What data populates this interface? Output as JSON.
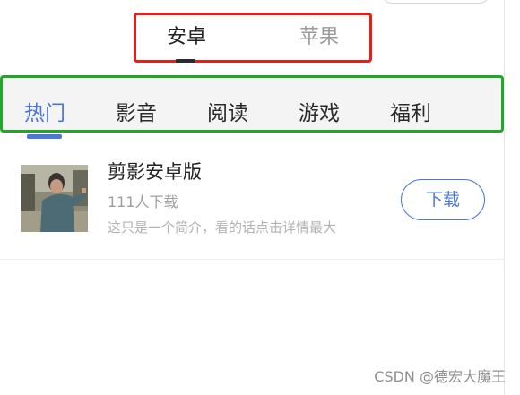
{
  "platform_tabs": [
    {
      "label": "安卓",
      "active": true
    },
    {
      "label": "苹果",
      "active": false
    }
  ],
  "category_tabs": [
    {
      "label": "热门",
      "active": true
    },
    {
      "label": "影音",
      "active": false
    },
    {
      "label": "阅读",
      "active": false
    },
    {
      "label": "游戏",
      "active": false
    },
    {
      "label": "福利",
      "active": false
    }
  ],
  "apps": [
    {
      "title": "剪影安卓版",
      "downloads": "111人下载",
      "description": "这只是一个简介，看的话点击详情最大",
      "button_label": "下载"
    }
  ],
  "watermark": "CSDN @德宏大魔王",
  "colors": {
    "accent": "#4a78d8",
    "annotation_red": "#e0221b",
    "annotation_green": "#22a62a"
  }
}
